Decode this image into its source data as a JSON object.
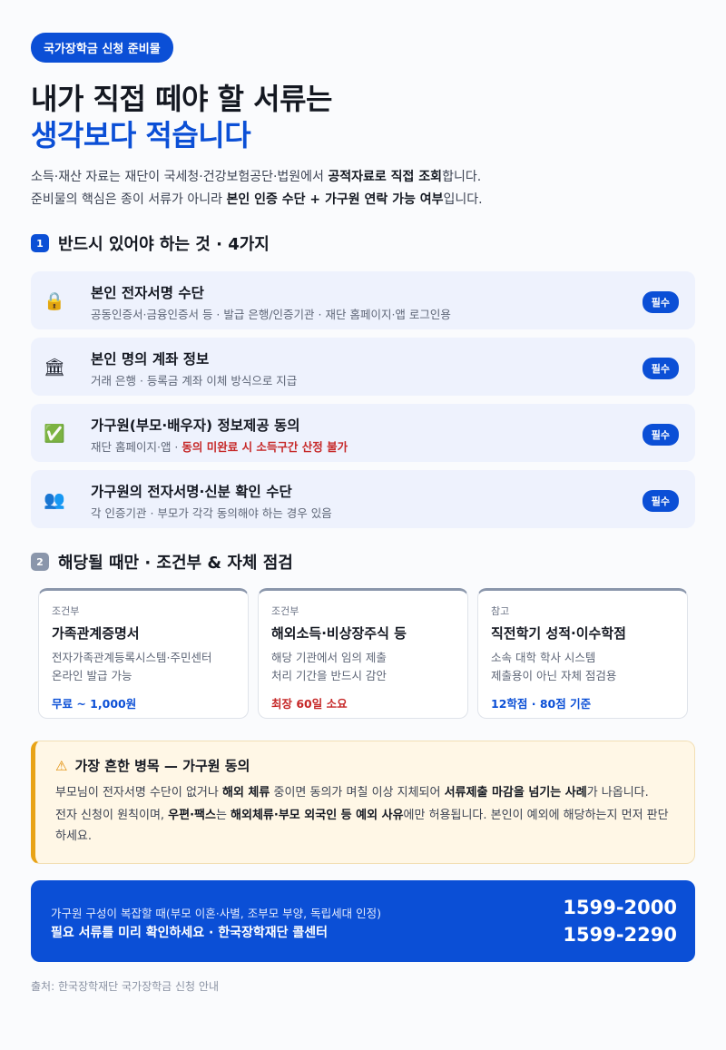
{
  "tag": "국가장학금 신청 준비물",
  "headline_1": "내가 직접 떼야 할 서류는",
  "headline_2": "생각보다 적습니다",
  "lead": {
    "l1_a": "소득·재산 자료는 재단이 국세청·건강보험공단·법원에서 ",
    "l1_b": "공적자료로 직접 조회",
    "l1_c": "합니다.",
    "l2_a": "준비물의 핵심은 종이 서류가 아니라 ",
    "l2_b": "본인 인증 수단 + 가구원 연락 가능 여부",
    "l2_c": "입니다."
  },
  "section1": {
    "num": "1",
    "title": "반드시 있어야 하는 것 · 4가지"
  },
  "required": [
    {
      "icon": "lock-icon",
      "glyph": "🔒",
      "title": "본인 전자서명 수단",
      "sub": "공동인증서·금융인증서 등 · 발급 은행/인증기관 · 재단 홈페이지·앱 로그인용",
      "badge": "필수"
    },
    {
      "icon": "bank-icon",
      "glyph": "🏛",
      "title": "본인 명의 계좌 정보",
      "sub": "거래 은행 · 등록금 계좌 이체 방식으로 지급",
      "badge": "필수"
    },
    {
      "icon": "check-icon",
      "glyph": "✅",
      "title": "가구원(부모·배우자) 정보제공 동의",
      "sub_a": "재단 홈페이지·앱 · ",
      "sub_b": "동의 미완료 시 소득구간 산정 불가",
      "badge": "필수"
    },
    {
      "icon": "people-icon",
      "glyph": "👥",
      "title": "가구원의 전자서명·신분 확인 수단",
      "sub": "각 인증기관 · 부모가 각각 동의해야 하는 경우 있음",
      "badge": "필수"
    }
  ],
  "section2": {
    "num": "2",
    "title": "해당될 때만 · 조건부 & 자체 점검"
  },
  "cards": [
    {
      "kind": "조건부",
      "title": "가족관계증명서",
      "d1": "전자가족관계등록시스템·주민센터",
      "d2": "온라인 발급 가능",
      "foot": "무료 ~ 1,000원",
      "tone": "blue"
    },
    {
      "kind": "조건부",
      "title": "해외소득·비상장주식 등",
      "d1": "해당 기관에서 임의 제출",
      "d2": "처리 기간을 반드시 감안",
      "foot": "최장 60일 소요",
      "tone": "red"
    },
    {
      "kind": "참고",
      "title": "직전학기 성적·이수학점",
      "d1": "소속 대학 학사 시스템",
      "d2": "제출용이 아닌 자체 점검용",
      "foot": "12학점 · 80점 기준",
      "tone": "blue"
    }
  ],
  "alert": {
    "title": "가장 흔한 병목 — 가구원 동의",
    "p1_a": "부모님이 전자서명 수단이 없거나 ",
    "p1_b": "해외 체류",
    "p1_c": " 중이면 동의가 며칠 이상 지체되어 ",
    "p1_d": "서류제출 마감을 넘기는 사례",
    "p1_e": "가 나옵니다.",
    "p2_a": "전자 신청이 원칙이며, ",
    "p2_b": "우편·팩스",
    "p2_c": "는 ",
    "p2_d": "해외체류·부모 외국인 등 예외 사유",
    "p2_e": "에만 허용됩니다. 본인이 예외에 해당하는지 먼저 판단하세요."
  },
  "cta": {
    "line1": "가구원 구성이 복잡할 때(부모 이혼·사별, 조부모 부양, 독립세대 인정)",
    "line2": "필요 서류를 미리 확인하세요 · 한국장학재단 콜센터",
    "phone1": "1599-2000",
    "phone2": "1599-2290"
  },
  "source": "출처: 한국장학재단 국가장학금 신청 안내",
  "colors": {
    "accent": "#0b4fd6",
    "warning": "#c62828",
    "alert_border": "#e8a317"
  }
}
